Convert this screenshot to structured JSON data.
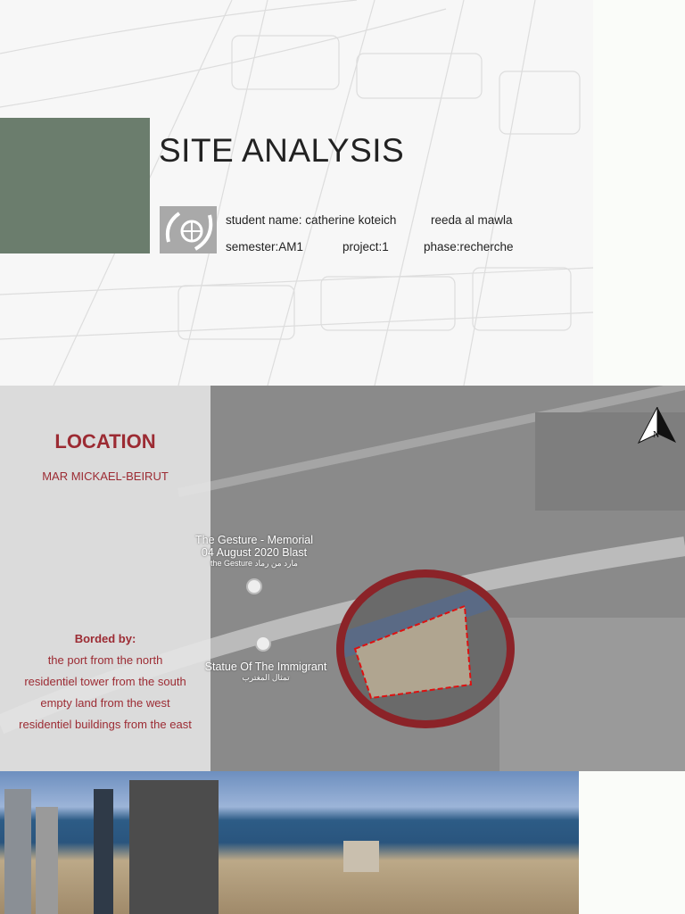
{
  "header": {
    "title": "SITE ANALYSIS",
    "student_line": "student name: catherine koteich",
    "partner": "reeda al mawla",
    "semester": "semester:AM1",
    "project": "project:1",
    "phase": "phase:recherche"
  },
  "location": {
    "heading": "LOCATION",
    "area": "MAR MICKAEL-BEIRUT",
    "borded_heading": "Borded by:",
    "borders": [
      "the port from the north",
      "residentiel tower from the south",
      "empty land from the west",
      "residentiel buildings from the east"
    ]
  },
  "map": {
    "poi1_line1": "The Gesture - Memorial",
    "poi1_line2": "04 August 2020 Blast",
    "poi1_sub": "the Gesture مارد من رماد",
    "poi2": "Statue Of The Immigrant",
    "poi2_sub": "تمثال المغترب",
    "north": "N"
  },
  "colors": {
    "accent": "#9c2b33",
    "green": "#6b7d6d"
  }
}
